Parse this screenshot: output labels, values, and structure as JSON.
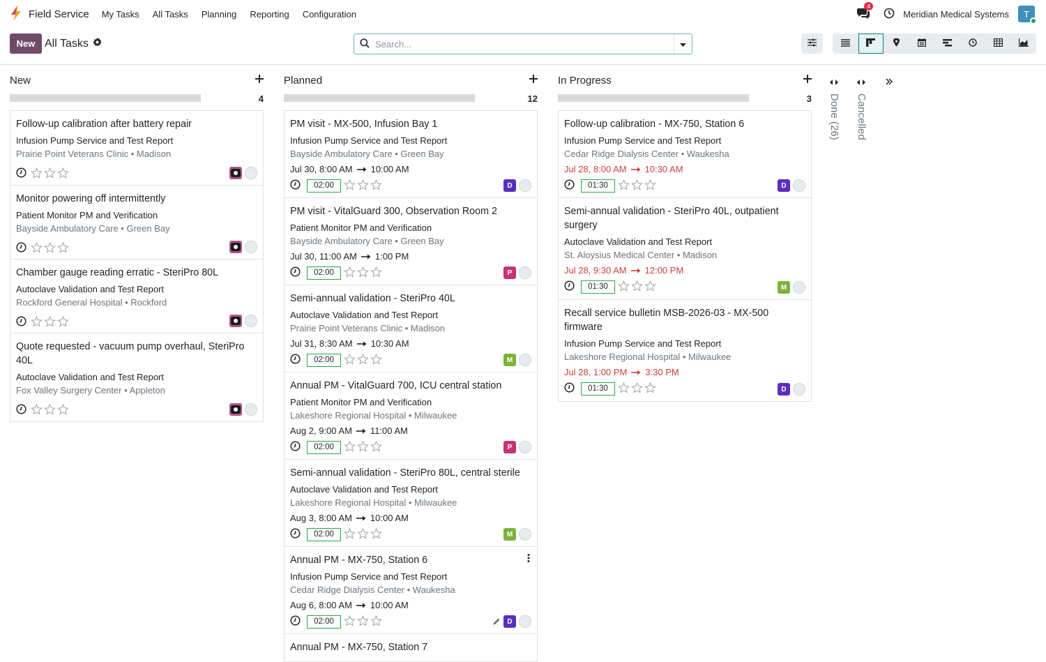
{
  "app": {
    "name": "Field Service",
    "menu": [
      "My Tasks",
      "All Tasks",
      "Planning",
      "Reporting",
      "Configuration"
    ],
    "messages_count": "4",
    "company": "Meridian Medical Systems",
    "user_initial": "T"
  },
  "control_panel": {
    "new_label": "New",
    "title": "All Tasks",
    "search_placeholder": "Search..."
  },
  "colors": {
    "brand": "#714b67",
    "accent": "#017e84",
    "late": "#d23f3a",
    "duration_border": "#28a745",
    "avatar_D": "#5b2fbd",
    "avatar_P": "#c63278",
    "avatar_M": "#7bb33a"
  },
  "columns": [
    {
      "title": "New",
      "count": "4",
      "cards": [
        {
          "title": "Follow-up calibration after battery repair",
          "subtitle": "Infusion Pump Service and Test Report",
          "customer": "Prairie Point Veterans Clinic",
          "city": "Madison",
          "avatar": "camera"
        },
        {
          "title": "Monitor powering off intermittently",
          "subtitle": "Patient Monitor PM and Verification",
          "customer": "Bayside Ambulatory Care",
          "city": "Green Bay",
          "avatar": "camera"
        },
        {
          "title": "Chamber gauge reading erratic - SteriPro 80L",
          "subtitle": "Autoclave Validation and Test Report",
          "customer": "Rockford General Hospital",
          "city": "Rockford",
          "avatar": "camera"
        },
        {
          "title": "Quote requested - vacuum pump overhaul, SteriPro 40L",
          "subtitle": "Autoclave Validation and Test Report",
          "customer": "Fox Valley Surgery Center",
          "city": "Appleton",
          "avatar": "camera"
        }
      ]
    },
    {
      "title": "Planned",
      "count": "12",
      "cards": [
        {
          "title": "PM visit - MX-500, Infusion Bay 1",
          "subtitle": "Infusion Pump Service and Test Report",
          "customer": "Bayside Ambulatory Care",
          "city": "Green Bay",
          "start": "Jul 30, 8:00 AM",
          "end": "10:00 AM",
          "duration": "02:00",
          "avatar": "D"
        },
        {
          "title": "PM visit - VitalGuard 300, Observation Room 2",
          "subtitle": "Patient Monitor PM and Verification",
          "customer": "Bayside Ambulatory Care",
          "city": "Green Bay",
          "start": "Jul 30, 11:00 AM",
          "end": "1:00 PM",
          "duration": "02:00",
          "avatar": "P"
        },
        {
          "title": "Semi-annual validation - SteriPro 40L",
          "subtitle": "Autoclave Validation and Test Report",
          "customer": "Prairie Point Veterans Clinic",
          "city": "Madison",
          "start": "Jul 31, 8:30 AM",
          "end": "10:30 AM",
          "duration": "02:00",
          "avatar": "M"
        },
        {
          "title": "Annual PM - VitalGuard 700, ICU central station",
          "subtitle": "Patient Monitor PM and Verification",
          "customer": "Lakeshore Regional Hospital",
          "city": "Milwaukee",
          "start": "Aug 2, 9:00 AM",
          "end": "11:00 AM",
          "duration": "02:00",
          "avatar": "P"
        },
        {
          "title": "Semi-annual validation - SteriPro 80L, central sterile",
          "subtitle": "Autoclave Validation and Test Report",
          "customer": "Lakeshore Regional Hospital",
          "city": "Milwaukee",
          "start": "Aug 3, 8:00 AM",
          "end": "10:00 AM",
          "duration": "02:00",
          "avatar": "M"
        },
        {
          "title": "Annual PM - MX-750, Station 6",
          "subtitle": "Infusion Pump Service and Test Report",
          "customer": "Cedar Ridge Dialysis Center",
          "city": "Waukesha",
          "start": "Aug 6, 8:00 AM",
          "end": "10:00 AM",
          "duration": "02:00",
          "avatar": "D",
          "hovered": true
        },
        {
          "title": "Annual PM - MX-750, Station 7"
        }
      ]
    },
    {
      "title": "In Progress",
      "count": "3",
      "cards": [
        {
          "title": "Follow-up calibration - MX-750, Station 6",
          "subtitle": "Infusion Pump Service and Test Report",
          "customer": "Cedar Ridge Dialysis Center",
          "city": "Waukesha",
          "start": "Jul 28, 8:00 AM",
          "end": "10:30 AM",
          "duration": "01:30",
          "avatar": "D",
          "late": true
        },
        {
          "title": "Semi-annual validation - SteriPro 40L, outpatient surgery",
          "subtitle": "Autoclave Validation and Test Report",
          "customer": "St. Aloysius Medical Center",
          "city": "Madison",
          "start": "Jul 28, 9:30 AM",
          "end": "12:00 PM",
          "duration": "01:30",
          "avatar": "M",
          "late": true
        },
        {
          "title": "Recall service bulletin MSB-2026-03 - MX-500 firmware",
          "subtitle": "Infusion Pump Service and Test Report",
          "customer": "Lakeshore Regional Hospital",
          "city": "Milwaukee",
          "start": "Jul 28, 1:00 PM",
          "end": "3:30 PM",
          "duration": "01:30",
          "avatar": "D",
          "late": true
        }
      ]
    }
  ],
  "folded_columns": [
    {
      "label": "Done (26)"
    },
    {
      "label": "Cancelled"
    }
  ]
}
